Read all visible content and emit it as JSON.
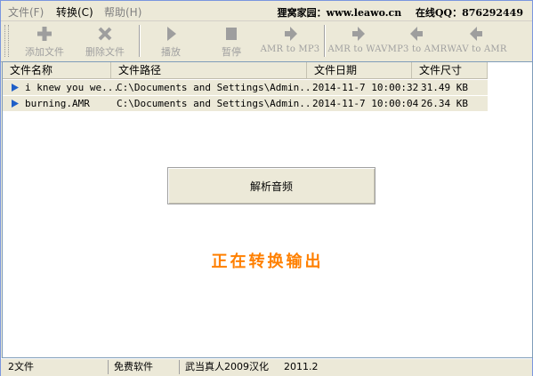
{
  "menu": {
    "items": [
      "文件(F)",
      "转换(C)",
      "帮助(H)"
    ],
    "info_site": "狸窝家园：www.leawo.cn",
    "info_qq": "在线QQ：876292449"
  },
  "toolbar": {
    "add_label": "添加文件",
    "remove_label": "删除文件",
    "play_label": "播放",
    "pause_label": "暂停",
    "amr_to_mp3_label": "AMR to MP3",
    "amr_to_wav_label": "AMR to WAV",
    "mp3_to_amr_label": "MP3 to AMR",
    "wav_to_amr_label": "WAV to AMR"
  },
  "list": {
    "columns": [
      "文件名称",
      "文件路径",
      "文件日期",
      "文件尺寸"
    ],
    "rows": [
      {
        "name": "i knew you we...",
        "path": "C:\\Documents and Settings\\Admin...",
        "date": "2014-11-7 10:00:32",
        "size": "31.49 KB"
      },
      {
        "name": "burning.AMR",
        "path": "C:\\Documents and Settings\\Admin...",
        "date": "2014-11-7 10:00:04",
        "size": "26.34 KB"
      }
    ]
  },
  "parse_button_label": "解析音频",
  "status_message": "正在转换输出",
  "statusbar": {
    "file_count": "2文件",
    "license": "免费软件",
    "credit": "武当真人2009汉化",
    "version": "2011.2"
  },
  "colors": {
    "status_message": "#ff8000",
    "row_bg": "#ece9d8",
    "window_border": "#7a96df"
  }
}
